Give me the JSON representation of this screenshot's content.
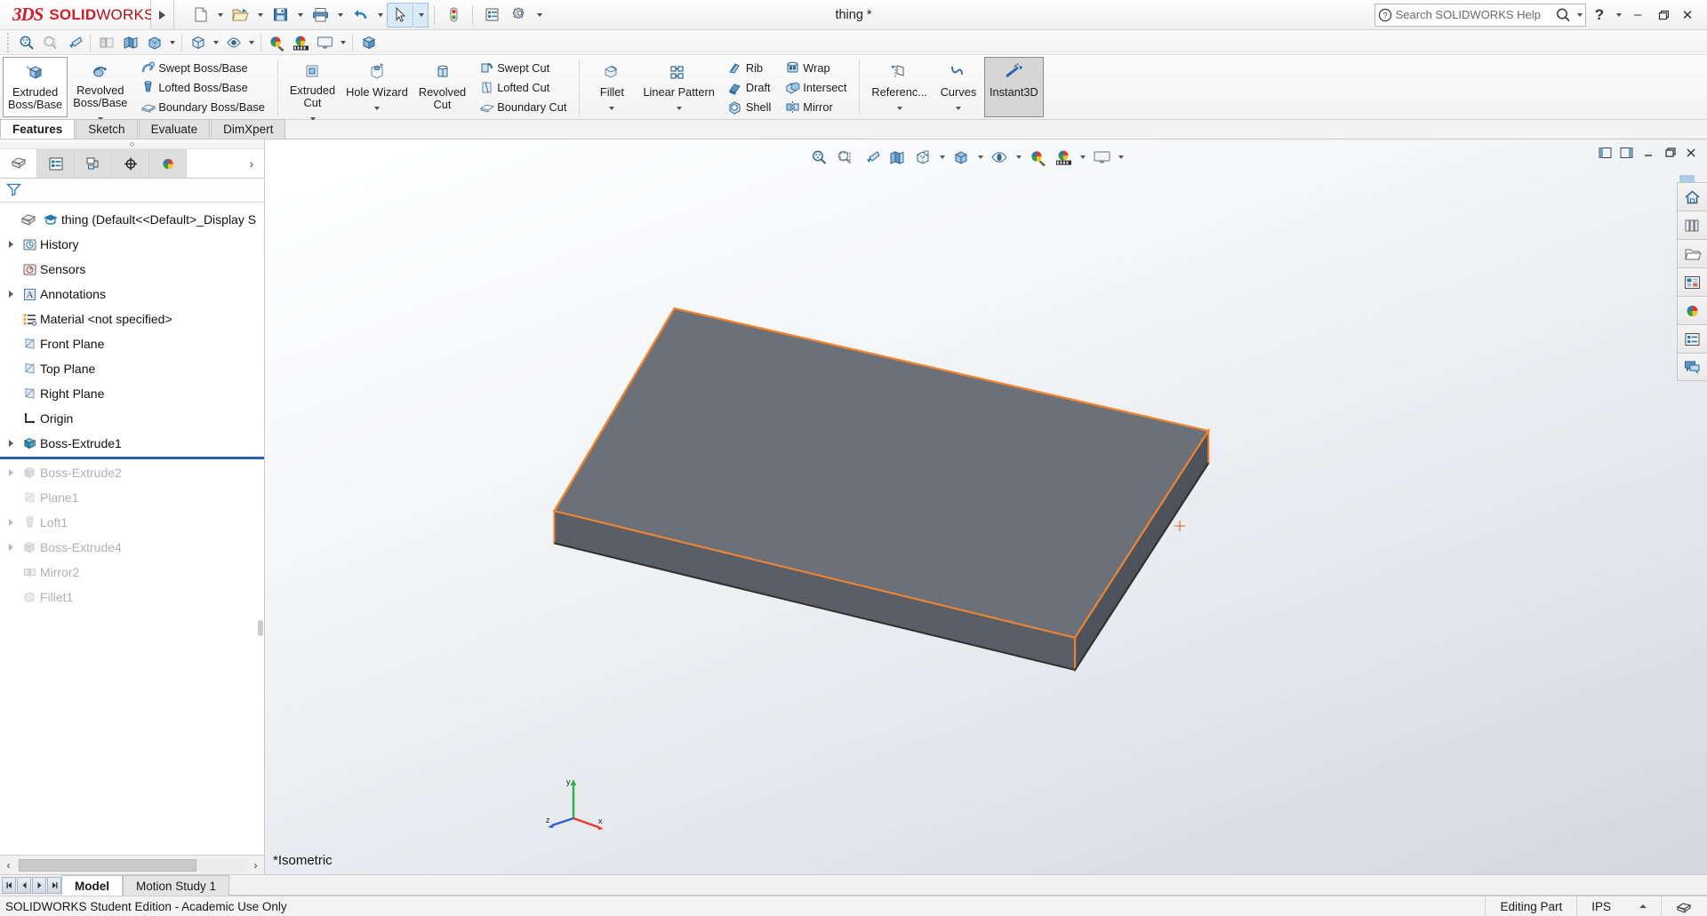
{
  "app": {
    "brand_ds": "3DS",
    "brand_solid": "SOLID",
    "brand_works": "WORKS",
    "document_title": "thing *",
    "accent_red": "#d01e2b",
    "selection_orange": "#ef8533",
    "rollback_blue": "#2b5faa"
  },
  "titlebar": {
    "search_placeholder": "Search SOLIDWORKS Help",
    "help_label": "?",
    "minimize_label": "–",
    "restore_label": "❐",
    "close_label": "✕",
    "quick_access": [
      {
        "name": "new-document",
        "has_caret": true
      },
      {
        "name": "open-document",
        "has_caret": true
      },
      {
        "name": "save-document",
        "has_caret": true
      },
      {
        "name": "print-document",
        "has_caret": true
      },
      {
        "name": "undo",
        "has_caret": true
      },
      {
        "name": "select",
        "has_caret": true,
        "selected": true
      },
      {
        "name": "rebuild",
        "has_caret": false
      },
      {
        "name": "options",
        "has_caret": false
      },
      {
        "name": "settings",
        "has_caret": true
      }
    ]
  },
  "icon_strip": [
    {
      "name": "zoom-to-area-icon"
    },
    {
      "name": "zoom-to-fit-icon"
    },
    {
      "name": "zoom-to-selection-icon"
    },
    {
      "name": "section-view-grey-icon"
    },
    {
      "name": "section-view-icon"
    },
    {
      "name": "display-style-icon"
    },
    {
      "name": "view-orientation-icon"
    },
    {
      "name": "hide-show-items-icon"
    },
    {
      "name": "edit-appearance-icon"
    },
    {
      "name": "apply-scene-icon"
    },
    {
      "name": "view-settings-icon"
    },
    {
      "name": "isometric-cube-icon"
    }
  ],
  "ribbon": {
    "groups": [
      {
        "name": "boss-base",
        "big": [
          {
            "label_line1": "Extruded",
            "label_line2": "Boss/Base",
            "icon": "extruded-boss-icon",
            "bordered": true,
            "caret": false
          },
          {
            "label_line1": "Revolved",
            "label_line2": "Boss/Base",
            "icon": "revolved-boss-icon",
            "bordered": false,
            "caret": true
          }
        ],
        "small": [
          {
            "label": "Swept Boss/Base",
            "icon": "swept-boss-icon"
          },
          {
            "label": "Lofted Boss/Base",
            "icon": "lofted-boss-icon"
          },
          {
            "label": "Boundary Boss/Base",
            "icon": "boundary-boss-icon"
          }
        ]
      },
      {
        "name": "cut",
        "big": [
          {
            "label_line1": "Extruded",
            "label_line2": "Cut",
            "icon": "extruded-cut-icon",
            "bordered": false,
            "caret": true
          },
          {
            "label_line1": "Hole Wizard",
            "label_line2": "",
            "icon": "hole-wizard-icon",
            "bordered": false,
            "caret": true
          },
          {
            "label_line1": "Revolved",
            "label_line2": "Cut",
            "icon": "revolved-cut-icon",
            "bordered": false,
            "caret": false
          }
        ],
        "small": [
          {
            "label": "Swept Cut",
            "icon": "swept-cut-icon"
          },
          {
            "label": "Lofted Cut",
            "icon": "lofted-cut-icon"
          },
          {
            "label": "Boundary Cut",
            "icon": "boundary-cut-icon"
          }
        ]
      },
      {
        "name": "features",
        "big": [
          {
            "label_line1": "Fillet",
            "label_line2": "",
            "icon": "fillet-icon",
            "bordered": false,
            "caret": true
          },
          {
            "label_line1": "Linear Pattern",
            "label_line2": "",
            "icon": "linear-pattern-icon",
            "bordered": false,
            "caret": true
          }
        ],
        "small": [
          {
            "label": "Rib",
            "icon": "rib-icon"
          },
          {
            "label": "Draft",
            "icon": "draft-icon"
          },
          {
            "label": "Shell",
            "icon": "shell-icon"
          }
        ],
        "small2": [
          {
            "label": "Wrap",
            "icon": "wrap-icon"
          },
          {
            "label": "Intersect",
            "icon": "intersect-icon"
          },
          {
            "label": "Mirror",
            "icon": "mirror-icon"
          }
        ]
      },
      {
        "name": "reference",
        "big": [
          {
            "label_line1": "Referenc...",
            "label_line2": "",
            "icon": "reference-geometry-icon",
            "bordered": false,
            "caret": true
          },
          {
            "label_line1": "Curves",
            "label_line2": "",
            "icon": "curves-icon",
            "bordered": false,
            "caret": true
          },
          {
            "label_line1": "Instant3D",
            "label_line2": "",
            "icon": "instant3d-icon",
            "bordered": false,
            "caret": false,
            "active": true
          }
        ],
        "small": []
      }
    ]
  },
  "command_tabs": [
    {
      "label": "Features",
      "selected": true
    },
    {
      "label": "Sketch",
      "selected": false
    },
    {
      "label": "Evaluate",
      "selected": false
    },
    {
      "label": "DimXpert",
      "selected": false
    }
  ],
  "feature_manager": {
    "tabs": [
      {
        "name": "feature-manager-tab",
        "icon": "feature-tree-icon",
        "selected": true
      },
      {
        "name": "property-manager-tab",
        "icon": "property-list-icon",
        "selected": false
      },
      {
        "name": "configuration-manager-tab",
        "icon": "configuration-icon",
        "selected": false
      },
      {
        "name": "dimxpert-manager-tab",
        "icon": "dimxpert-target-icon",
        "selected": false
      },
      {
        "name": "display-manager-tab",
        "icon": "display-sphere-icon",
        "selected": false
      }
    ],
    "expand_label": "›",
    "filter_icon": "filter-funnel-icon",
    "tree": [
      {
        "label": "thing  (Default<<Default>_Display S",
        "icon": "part-document-icon",
        "twisty": false,
        "dimmed": false,
        "indent": 0,
        "extra_icon": "graduation-cap-icon"
      },
      {
        "label": "History",
        "icon": "history-icon",
        "twisty": true,
        "dimmed": false,
        "indent": 1
      },
      {
        "label": "Sensors",
        "icon": "sensors-icon",
        "twisty": false,
        "dimmed": false,
        "indent": 1
      },
      {
        "label": "Annotations",
        "icon": "annotations-icon",
        "twisty": true,
        "dimmed": false,
        "indent": 1
      },
      {
        "label": "Material <not specified>",
        "icon": "material-icon",
        "twisty": false,
        "dimmed": false,
        "indent": 1
      },
      {
        "label": "Front Plane",
        "icon": "plane-icon",
        "twisty": false,
        "dimmed": false,
        "indent": 1
      },
      {
        "label": "Top Plane",
        "icon": "plane-icon",
        "twisty": false,
        "dimmed": false,
        "indent": 1
      },
      {
        "label": "Right Plane",
        "icon": "plane-icon",
        "twisty": false,
        "dimmed": false,
        "indent": 1
      },
      {
        "label": "Origin",
        "icon": "origin-icon",
        "twisty": false,
        "dimmed": false,
        "indent": 1
      },
      {
        "label": "Boss-Extrude1",
        "icon": "boss-extrude-icon",
        "twisty": true,
        "dimmed": false,
        "indent": 1
      },
      {
        "label": "Boss-Extrude2",
        "icon": "boss-extrude-icon",
        "twisty": true,
        "dimmed": true,
        "indent": 1
      },
      {
        "label": "Plane1",
        "icon": "plane-grey-icon",
        "twisty": false,
        "dimmed": true,
        "indent": 1
      },
      {
        "label": "Loft1",
        "icon": "loft-icon",
        "twisty": true,
        "dimmed": true,
        "indent": 1
      },
      {
        "label": "Boss-Extrude4",
        "icon": "boss-extrude-icon",
        "twisty": true,
        "dimmed": true,
        "indent": 1
      },
      {
        "label": "Mirror2",
        "icon": "mirror-feature-icon",
        "twisty": false,
        "dimmed": true,
        "indent": 1
      },
      {
        "label": "Fillet1",
        "icon": "fillet-feature-icon",
        "twisty": false,
        "dimmed": true,
        "indent": 1
      }
    ],
    "rollback_after_index": 9,
    "hscroll_left": "‹",
    "hscroll_right": "›"
  },
  "viewport": {
    "toolbar": [
      {
        "name": "zoom-to-fit-icon",
        "caret": false
      },
      {
        "name": "zoom-to-area-icon",
        "caret": false
      },
      {
        "name": "previous-view-icon",
        "caret": false
      },
      {
        "name": "section-view-icon",
        "caret": false
      },
      {
        "name": "view-orientation-icon",
        "caret": true
      },
      {
        "name": "display-style-icon",
        "caret": true
      },
      {
        "name": "hide-show-items-icon",
        "caret": true
      },
      {
        "name": "edit-appearance-icon",
        "caret": false
      },
      {
        "name": "apply-scene-icon",
        "caret": true
      },
      {
        "name": "view-settings-icon",
        "caret": true
      }
    ],
    "window_buttons": [
      {
        "name": "tile-left-icon"
      },
      {
        "name": "tile-right-icon"
      },
      {
        "name": "minimize-view-icon",
        "label": "–"
      },
      {
        "name": "restore-view-icon",
        "label": "❐"
      },
      {
        "name": "close-view-icon",
        "label": "✕"
      }
    ],
    "view_name": "*Isometric",
    "triad": {
      "x_label": "x",
      "y_label": "y",
      "z_label": "z"
    },
    "model": {
      "face_color": "#6c7078",
      "side_color": "#5a5e66",
      "front_color": "#565a62",
      "edge_color": "#ef8533"
    }
  },
  "task_pane": [
    {
      "name": "solidworks-resources-icon"
    },
    {
      "name": "design-library-icon"
    },
    {
      "name": "file-explorer-icon"
    },
    {
      "name": "view-palette-icon"
    },
    {
      "name": "appearances-scenes-icon"
    },
    {
      "name": "custom-properties-icon"
    },
    {
      "name": "solidworks-forum-icon"
    }
  ],
  "bottom": {
    "nav_buttons": [
      "⏮",
      "◀",
      "▶",
      "⏭"
    ],
    "tabs": [
      {
        "label": "Model",
        "selected": true
      },
      {
        "label": "Motion Study 1",
        "selected": false
      }
    ]
  },
  "status_bar": {
    "left_text": "SOLIDWORKS Student Edition - Academic Use Only",
    "editing_state": "Editing Part",
    "units": "IPS",
    "caret": "▴",
    "overlay_icon": "overlay-icon"
  }
}
